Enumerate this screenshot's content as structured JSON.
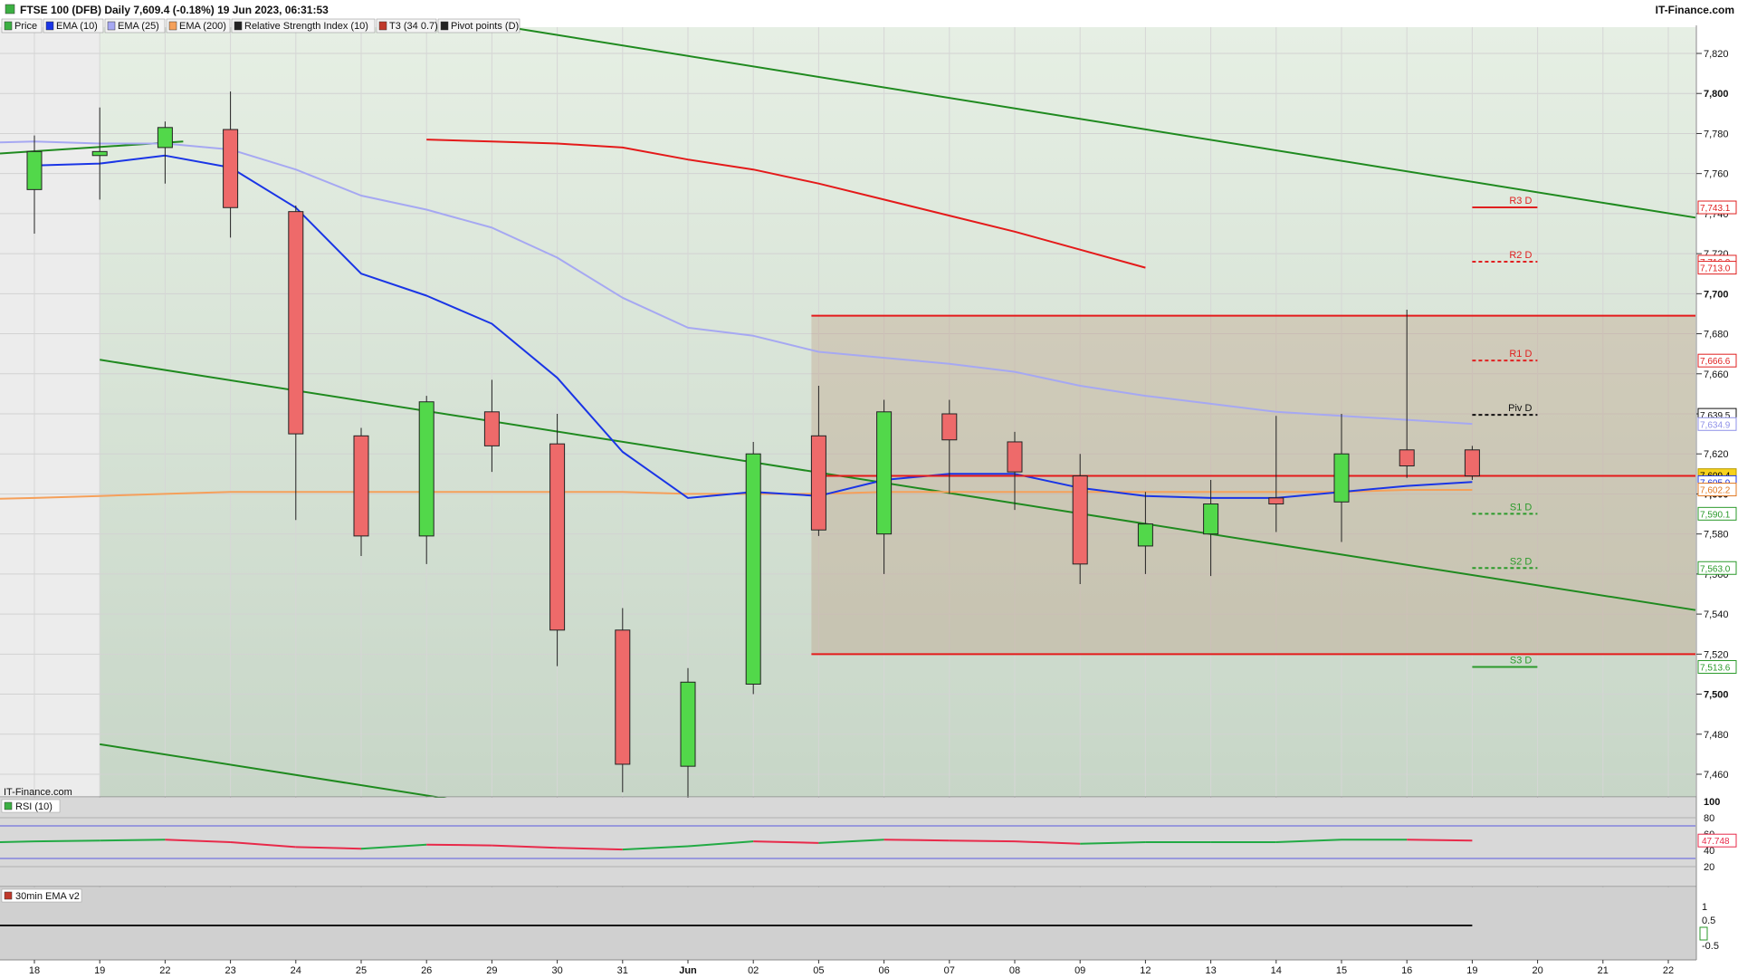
{
  "header": {
    "title": "FTSE 100 (DFB) Daily 7,609.4 (-0.18%) 19 Jun 2023, 06:31:53",
    "brand": "IT-Finance.com"
  },
  "legend": [
    {
      "label": "Price",
      "color": "#3cb043"
    },
    {
      "label": "EMA (10)",
      "color": "#1a35e6"
    },
    {
      "label": "EMA (25)",
      "color": "#a6a8f2"
    },
    {
      "label": "EMA (200)",
      "color": "#f5a05a"
    },
    {
      "label": "Relative Strength Index (10)",
      "color": "#222222"
    },
    {
      "label": "T3 (34 0.7)",
      "color": "#c0392b"
    },
    {
      "label": "Pivot points (D)",
      "color": "#222222"
    }
  ],
  "watermark": "IT-Finance.com",
  "rsi_panel": {
    "label": "RSI (10)",
    "value_label": "47.748"
  },
  "ema_panel": {
    "label": "30min EMA v2"
  },
  "pivots": [
    {
      "name": "R3 D",
      "value": 7743.1,
      "label": "7,743.1",
      "color": "#e02020"
    },
    {
      "name": "R2 D",
      "value": 7716.0,
      "label": "7,716.0",
      "color": "#e02020"
    },
    {
      "name": "R1 D",
      "value": 7666.6,
      "label": "7,666.6",
      "color": "#e02020"
    },
    {
      "name": "Piv D",
      "value": 7639.5,
      "label": "7,639.5",
      "color": "#111111"
    },
    {
      "name": "S1 D",
      "value": 7590.1,
      "label": "7,590.1",
      "color": "#2a9a2a"
    },
    {
      "name": "S2 D",
      "value": 7563.0,
      "label": "7,563.0",
      "color": "#2a9a2a"
    },
    {
      "name": "S3 D",
      "value": 7513.6,
      "label": "7,513.6",
      "color": "#2a9a2a"
    }
  ],
  "price_tags": [
    {
      "label": "7,713.0",
      "value": 7713.0,
      "color": "#e02020"
    },
    {
      "label": "7,634.9",
      "value": 7634.9,
      "color": "#8f91e8"
    },
    {
      "label": "7,609.4",
      "value": 7609.4,
      "color": "#000000",
      "bg": "#f7d21e"
    },
    {
      "label": "7,605.9",
      "value": 7605.9,
      "color": "#1a35e6"
    },
    {
      "label": "7,602.2",
      "value": 7602.2,
      "color": "#e07820"
    }
  ],
  "chart_data": {
    "type": "candlestick",
    "y_ticks": [
      7460,
      7480,
      7500,
      7520,
      7540,
      7560,
      7580,
      7600,
      7620,
      7640,
      7660,
      7680,
      7700,
      7720,
      7740,
      7760,
      7780,
      7800,
      7820
    ],
    "y_tick_labels": [
      "7,460",
      "7,480",
      "7,500",
      "7,520",
      "7,540",
      "7,560",
      "7,580",
      "7,600",
      "7,620",
      "7,640",
      "7,660",
      "7,680",
      "7,700",
      "7,720",
      "7,740",
      "7,760",
      "7,780",
      "7,800",
      "7,820"
    ],
    "ylim": [
      7443,
      7830
    ],
    "x_labels": [
      "18",
      "19",
      "22",
      "23",
      "24",
      "25",
      "26",
      "29",
      "30",
      "31",
      "Jun",
      "02",
      "05",
      "06",
      "07",
      "08",
      "09",
      "12",
      "13",
      "14",
      "15",
      "16",
      "19",
      "20",
      "21",
      "22"
    ],
    "candles": [
      {
        "date": "18",
        "open": 7752,
        "high": 7779,
        "low": 7730,
        "close": 7771
      },
      {
        "date": "19",
        "open": 7769,
        "high": 7793,
        "low": 7747,
        "close": 7771
      },
      {
        "date": "22",
        "open": 7773,
        "high": 7786,
        "low": 7755,
        "close": 7783
      },
      {
        "date": "23",
        "open": 7782,
        "high": 7801,
        "low": 7728,
        "close": 7743
      },
      {
        "date": "24",
        "open": 7741,
        "high": 7744,
        "low": 7587,
        "close": 7630
      },
      {
        "date": "25",
        "open": 7629,
        "high": 7633,
        "low": 7569,
        "close": 7579
      },
      {
        "date": "26",
        "open": 7579,
        "high": 7649,
        "low": 7565,
        "close": 7646
      },
      {
        "date": "29",
        "open": 7641,
        "high": 7657,
        "low": 7611,
        "close": 7624
      },
      {
        "date": "30",
        "open": 7625,
        "high": 7640,
        "low": 7514,
        "close": 7532
      },
      {
        "date": "31",
        "open": 7532,
        "high": 7543,
        "low": 7451,
        "close": 7465
      },
      {
        "date": "Jun",
        "open": 7464,
        "high": 7513,
        "low": 7447,
        "close": 7506
      },
      {
        "date": "02",
        "open": 7505,
        "high": 7626,
        "low": 7500,
        "close": 7620
      },
      {
        "date": "05",
        "open": 7629,
        "high": 7654,
        "low": 7579,
        "close": 7582
      },
      {
        "date": "06",
        "open": 7580,
        "high": 7647,
        "low": 7560,
        "close": 7641
      },
      {
        "date": "07",
        "open": 7640,
        "high": 7647,
        "low": 7600,
        "close": 7627
      },
      {
        "date": "08",
        "open": 7626,
        "high": 7631,
        "low": 7592,
        "close": 7611
      },
      {
        "date": "09",
        "open": 7609,
        "high": 7620,
        "low": 7555,
        "close": 7565
      },
      {
        "date": "12",
        "open": 7574,
        "high": 7601,
        "low": 7560,
        "close": 7585
      },
      {
        "date": "13",
        "open": 7580,
        "high": 7607,
        "low": 7559,
        "close": 7595
      },
      {
        "date": "14",
        "open": 7598,
        "high": 7639,
        "low": 7581,
        "close": 7595
      },
      {
        "date": "15",
        "open": 7596,
        "high": 7640,
        "low": 7576,
        "close": 7620
      },
      {
        "date": "16",
        "open": 7622,
        "high": 7692,
        "low": 7608,
        "close": 7614
      },
      {
        "date": "19",
        "open": 7622,
        "high": 7624,
        "low": 7607,
        "close": 7609
      }
    ],
    "ema10": [
      7764,
      7765,
      7769,
      7763,
      7743,
      7710,
      7699,
      7685,
      7658,
      7621,
      7598,
      7601,
      7599,
      7607,
      7610,
      7610,
      7603,
      7599,
      7598,
      7598,
      7601,
      7604,
      7606
    ],
    "ema25": [
      7776,
      7775,
      7775,
      7772,
      7762,
      7749,
      7742,
      7733,
      7718,
      7698,
      7683,
      7679,
      7671,
      7668,
      7665,
      7661,
      7654,
      7649,
      7645,
      7641,
      7639,
      7637,
      7635
    ],
    "ema200": [
      7598,
      7599,
      7600,
      7601,
      7601,
      7601,
      7601,
      7601,
      7601,
      7601,
      7600,
      7600,
      7600,
      7601,
      7601,
      7601,
      7601,
      7601,
      7601,
      7601,
      7601,
      7602,
      7602
    ],
    "t3": [
      7777,
      7776,
      7775,
      7773,
      7767,
      7762,
      7755,
      7747,
      7739,
      7731,
      7722,
      7713
    ],
    "range_box": {
      "from": "05",
      "top": 7689,
      "bottom": 7520
    },
    "channel": {
      "upper_start": 7667,
      "upper_end": 7542,
      "lower_start": 7475,
      "mid_start": 7770,
      "mid_end": 7738
    },
    "rsi": [
      51,
      52,
      53,
      50,
      44,
      42,
      47,
      46,
      43,
      41,
      45,
      51,
      49,
      53,
      52,
      51,
      48,
      50,
      50,
      50,
      53,
      53,
      52
    ],
    "rsi_levels": [
      80,
      70,
      30,
      20
    ],
    "rsi_ticks": [
      "100",
      "80",
      "60",
      "40",
      "20"
    ],
    "ema_panel_ticks": [
      "1",
      "0.5",
      "0",
      "-0.5"
    ]
  }
}
